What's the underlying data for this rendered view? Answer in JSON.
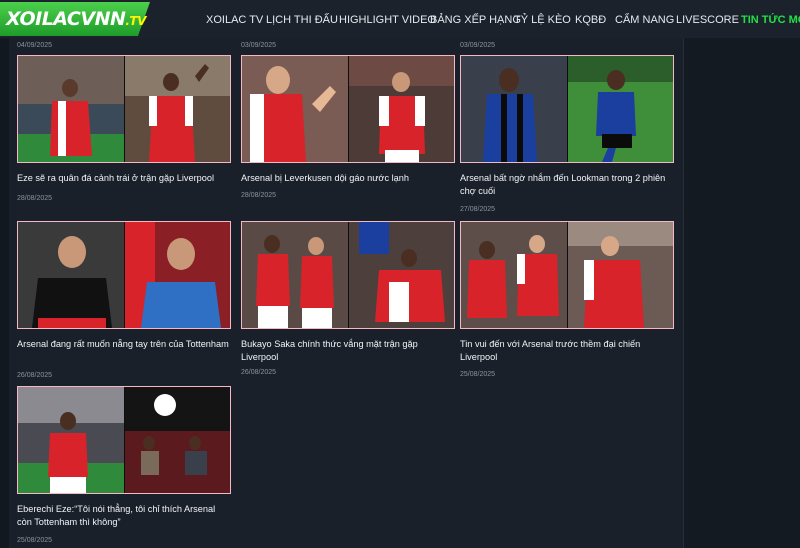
{
  "header": {
    "logo": {
      "name": "XOILACVNN",
      "tld": ".TV"
    },
    "nav": [
      {
        "label": "XOILAC TV"
      },
      {
        "label": "LỊCH THI ĐẤU"
      },
      {
        "label": "HIGHLIGHT VIDEO"
      },
      {
        "label": "BẢNG XẾP HẠNG"
      },
      {
        "label": "TỶ LỆ KÈO"
      },
      {
        "label": "KQBĐ"
      },
      {
        "label": "CẨM NANG"
      },
      {
        "label": "LIVESCORE"
      },
      {
        "label": "TIN TỨC MỚI",
        "active": true
      }
    ]
  },
  "top_dates": [
    "04/09/2025",
    "03/09/2025",
    "03/09/2025"
  ],
  "articles": [
    {
      "title": "Eze sẽ ra quân đá cảnh trái ở trận gặp Liverpool",
      "date": "28/08/2025"
    },
    {
      "title": "Arsenal bị Leverkusen dội gáo nước lạnh",
      "date": "28/08/2025"
    },
    {
      "title": "Arsenal bất ngờ nhắm đến Lookman trong 2 phiên chợ cuối",
      "date": "27/08/2025"
    },
    {
      "title": "Arsenal đang rất muốn nẵng tay trên của Tottenham",
      "date": "26/08/2025"
    },
    {
      "title": "Bukayo Saka chính thức vắng mặt trận gặp Liverpool",
      "date": "26/08/2025"
    },
    {
      "title": "Tin vui đến với Arsenal trước thềm đại chiến Liverpool",
      "date": "25/08/2025"
    },
    {
      "title": "Eberechi Eze:“Tôi nói thẳng, tôi chỉ thích Arsenal còn Tottenham thì không”",
      "date": "25/08/2025"
    }
  ],
  "colors": {
    "brand_green": "#22e046",
    "arsenal_red": "#d8232a",
    "atalanta_blue": "#1a3f9e",
    "leverkusen_black": "#111111",
    "card_border": "#f3b7c6"
  }
}
